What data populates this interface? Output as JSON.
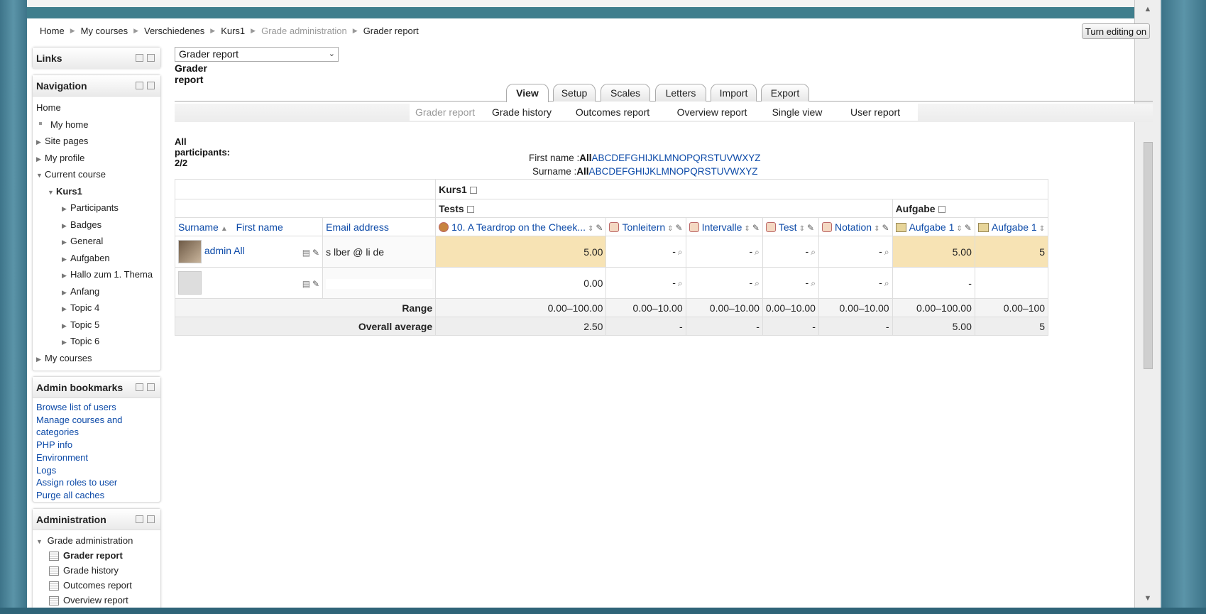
{
  "breadcrumb": {
    "items": [
      "Home",
      "My courses",
      "Verschiedenes",
      "Kurs1",
      "Grade administration",
      "Grader report"
    ]
  },
  "header": {
    "turn_editing_label": "Turn editing on"
  },
  "blocks": {
    "links": {
      "title": "Links"
    },
    "navigation": {
      "title": "Navigation",
      "home": "Home",
      "my_home": "My home",
      "site_pages": "Site pages",
      "my_profile": "My profile",
      "current_course": "Current course",
      "course": "Kurs1",
      "sections": [
        "Participants",
        "Badges",
        "General",
        "Aufgaben",
        "Hallo zum 1. Thema",
        "Anfang",
        "Topic 4",
        "Topic 5",
        "Topic 6"
      ],
      "my_courses": "My courses"
    },
    "admin_bookmarks": {
      "title": "Admin bookmarks",
      "links": [
        "Browse list of users",
        "Manage courses and",
        "categories",
        "PHP info",
        "Environment",
        "Logs",
        "Assign roles to user",
        "Purge all caches"
      ]
    },
    "administration": {
      "title": "Administration",
      "grade_admin": "Grade administration",
      "items": [
        "Grader report",
        "Grade history",
        "Outcomes report",
        "Overview report"
      ]
    }
  },
  "main": {
    "select_value": "Grader report",
    "title": "Grader report",
    "tabs": [
      "View",
      "Setup",
      "Scales",
      "Letters",
      "Import",
      "Export"
    ],
    "subtabs": [
      "Grader report",
      "Grade history",
      "Outcomes report",
      "Overview report",
      "Single view",
      "User report"
    ],
    "participants": "All participants: 2/2",
    "first_name_label": "First name :",
    "surname_label": "Surname :",
    "all": "All",
    "letters": [
      "A",
      "B",
      "C",
      "D",
      "E",
      "F",
      "G",
      "H",
      "I",
      "J",
      "K",
      "L",
      "M",
      "N",
      "O",
      "P",
      "Q",
      "R",
      "S",
      "T",
      "U",
      "V",
      "W",
      "X",
      "Y",
      "Z"
    ]
  },
  "grid": {
    "course_cat": "Kurs1",
    "tests_cat": "Tests",
    "aufgabe_cat": "Aufgabe",
    "col_surname": "Surname",
    "col_firstname": "First name",
    "col_email": "Email address",
    "items": [
      "10. A Teardrop on the Cheek...",
      "Tonleitern",
      "Intervalle",
      "Test",
      "Notation",
      "Aufgabe 1",
      "Aufgabe 1"
    ],
    "user1_name_fragment": "admin All",
    "user1_email_fragment": "s          lber @     li      de",
    "row1": [
      "5.00",
      "-",
      "-",
      "-",
      "-",
      "5.00",
      "5"
    ],
    "row2": [
      "0.00",
      "-",
      "-",
      "-",
      "-",
      "-",
      ""
    ],
    "range_label": "Range",
    "range": [
      "0.00–100.00",
      "0.00–10.00",
      "0.00–10.00",
      "0.00–10.00",
      "0.00–10.00",
      "0.00–100.00",
      "0.00–100"
    ],
    "avg_label": "Overall average",
    "avg": [
      "2.50",
      "-",
      "-",
      "-",
      "-",
      "5.00",
      "5"
    ]
  }
}
